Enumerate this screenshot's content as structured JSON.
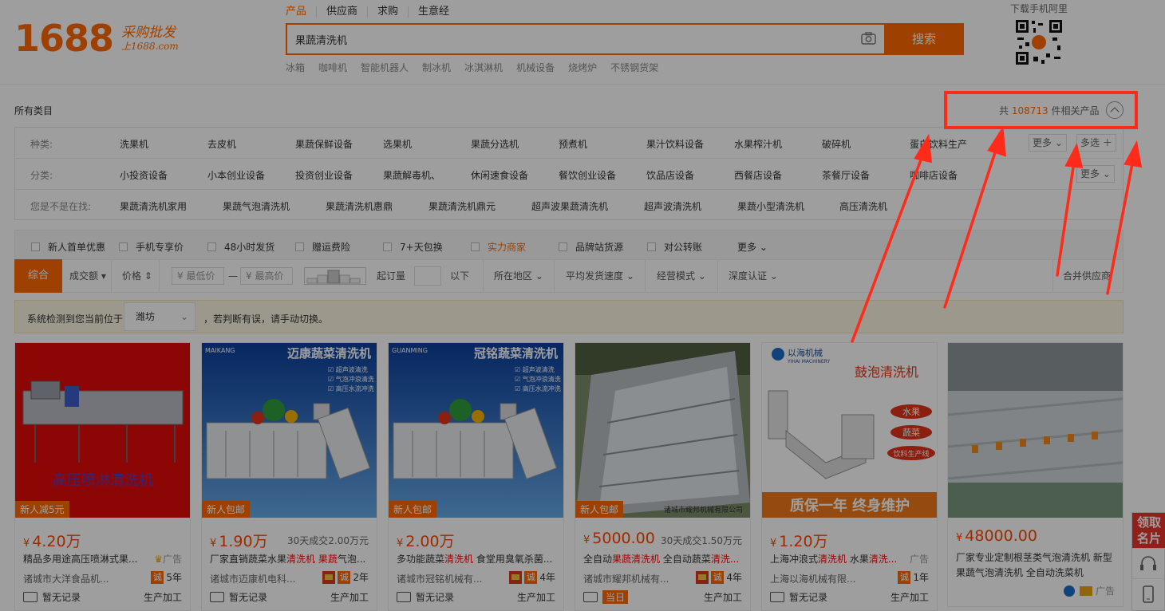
{
  "header": {
    "logo_number": "1688",
    "logo_tagline_1": "采购批发",
    "logo_tagline_2": "上1688.com",
    "search_tabs": [
      "产品",
      "供应商",
      "求购",
      "生意经"
    ],
    "search_value": "果蔬清洗机",
    "search_button": "搜索",
    "hot_words": [
      "冰箱",
      "咖啡机",
      "智能机器人",
      "制冰机",
      "冰淇淋机",
      "机械设备",
      "烧烤炉",
      "不锈钢货架"
    ],
    "qr_title": "下载手机阿里"
  },
  "category": {
    "crumb": "所有类目",
    "total_prefix": "共",
    "total_count": "108713",
    "total_suffix": "件相关产品",
    "rows": [
      {
        "label": "种类:",
        "items": [
          "洗果机",
          "去皮机",
          "果蔬保鲜设备",
          "选果机",
          "果蔬分选机",
          "预煮机",
          "果汁饮料设备",
          "水果榨汁机",
          "破碎机",
          "蛋白饮料生产"
        ],
        "more": "更多",
        "multi": "多选"
      },
      {
        "label": "分类:",
        "items": [
          "小投资设备",
          "小本创业设备",
          "投资创业设备",
          "果蔬解毒机、",
          "休闲速食设备",
          "餐饮创业设备",
          "饮品店设备",
          "西餐店设备",
          "茶餐厅设备",
          "咖啡店设备"
        ],
        "more": "更多"
      },
      {
        "label": "您是不是在找:",
        "items": [
          "果蔬清洗机家用",
          "果蔬气泡清洗机",
          "果蔬清洗机惠鼎",
          "果蔬清洗机鼎元",
          "超声波果蔬清洗机",
          "超声波清洗机",
          "果蔬小型清洗机",
          "高压清洗机"
        ]
      }
    ]
  },
  "options": [
    "新人首单优惠",
    "手机专享价",
    "48小时发货",
    "赠运费险",
    "7+天包换",
    "实力商家",
    "品牌站货源",
    "对公转账"
  ],
  "options_more": "更多",
  "sort": {
    "active": "综合",
    "volume": "成交额",
    "price": "价格",
    "min_price": "¥ 最低价",
    "dash": "—",
    "max_price": "¥ 最高价",
    "min_order": "起订量",
    "below": "以下",
    "region": "所在地区",
    "ship_speed": "平均发货速度",
    "biz_mode": "经营模式",
    "depth_cert": "深度认证",
    "merge": "合并供应商"
  },
  "location": {
    "notice": "系统检测到您当前位于",
    "city": "潍坊",
    "notice_tail": "，若判断有误，请手动切换。"
  },
  "products": [
    {
      "badge": "新人减5元",
      "price": "4.20万",
      "sold": "",
      "title_parts": [
        "精品多用途高压喷淋式果..."
      ],
      "ad": "广告",
      "company": "诸城市大洋食品机...",
      "years": "5年",
      "record": "暂无记录",
      "mode": "生产加工",
      "img_text": "高压喷淋清洗机"
    },
    {
      "badge": "新人包邮",
      "price": "1.90万",
      "sold": "30天成交2.00万元",
      "title_parts": [
        "厂家直销蔬菜水果",
        "清洗机",
        " ",
        "果蔬",
        "气泡..."
      ],
      "ad": "",
      "company": "诸城市迈康机电科...",
      "years": "2年",
      "record": "暂无记录",
      "mode": "生产加工",
      "img_text": "迈康蔬菜清洗机",
      "brand": "MAIKANG",
      "features": [
        "超声波清洗",
        "气泡冲浪清洗",
        "高压水流冲洗"
      ]
    },
    {
      "badge": "新人包邮",
      "price": "2.00万",
      "sold": "",
      "title_parts": [
        "多功能蔬菜",
        "清洗机",
        " 食堂用臭氧杀菌..."
      ],
      "ad": "",
      "company": "诸城市冠铭机械有...",
      "years": "4年",
      "record": "暂无记录",
      "mode": "生产加工",
      "img_text": "冠铭蔬菜清洗机",
      "brand": "GUANMING",
      "features": [
        "超声波清洗",
        "气泡冲浪清洗",
        "高压水流冲洗"
      ]
    },
    {
      "badge": "新人包邮",
      "price": "5000.00",
      "sold": "30天成交1.50万元",
      "title_parts": [
        "全自动",
        "果蔬清洗机",
        " 全自动蔬菜",
        "清洗..."
      ],
      "ad": "",
      "company": "诸城市耀邦机械有...",
      "years": "4年",
      "record": "当日",
      "mode": "生产加工",
      "img_text": "诸城市耀邦机械有限公司"
    },
    {
      "badge": "",
      "price": "1.20万",
      "sold": "",
      "title_parts": [
        "上海冲浪式",
        "清洗机",
        " 水果",
        "清洗..."
      ],
      "ad": "广告",
      "company": "上海以海机械有限...",
      "years": "1年",
      "record": "暂无记录",
      "mode": "生产加工",
      "img_text": "鼓泡清洗机",
      "brand": "以海机械",
      "brand_en": "YIHAI MACHINERY",
      "tags": [
        "水果",
        "蔬菜",
        "饮料生产线"
      ],
      "footer": "质保一年  终身维护"
    },
    {
      "badge": "",
      "price": "48000.00",
      "sold": "",
      "title_parts": [
        "厂家专业定制根茎类气泡清洗机 新型果蔬气泡清洗机 全自动洗菜机"
      ],
      "ad": "广告",
      "company": "",
      "years": "",
      "record": "",
      "mode": "",
      "img_text": ""
    }
  ],
  "side_tool": {
    "card": "领取名片"
  }
}
